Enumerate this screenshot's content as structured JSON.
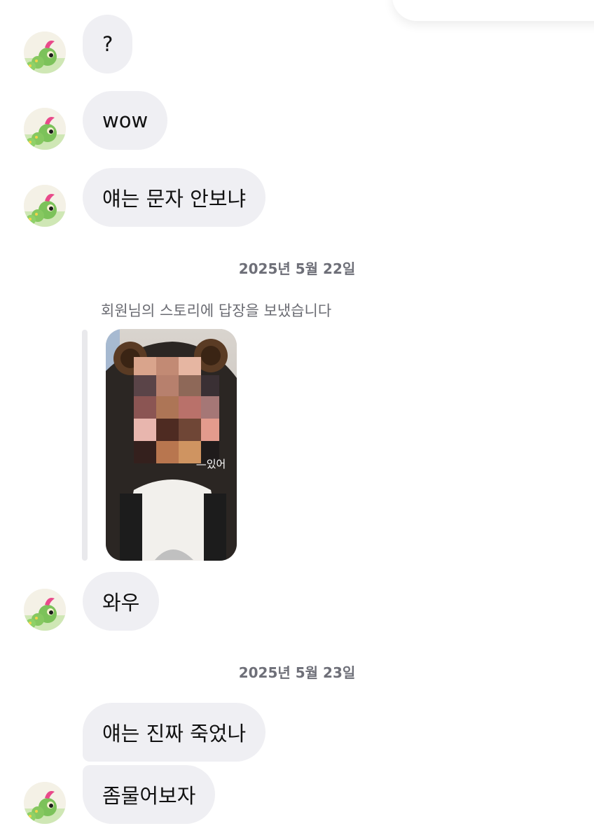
{
  "conversation": {
    "messages": [
      {
        "text": "?"
      },
      {
        "text": "wow"
      },
      {
        "text": "얘는 문자 안보냐"
      },
      {
        "text": "와우"
      },
      {
        "text": "얘는 진짜 죽었나"
      },
      {
        "text": "좀물어보자"
      }
    ],
    "date_separators": [
      {
        "text": "2025년 5월 22일"
      },
      {
        "text": "2025년 5월 23일"
      }
    ],
    "story_reply": {
      "note": "회원님의 스토리에 답장을 보냈습니다",
      "thumbnail_caption": "—있어"
    }
  },
  "colors": {
    "bubble_background": "#efeff3",
    "date_text": "#6e6f78",
    "note_text": "#6a6b72",
    "avatar_character": "#7cc25a"
  },
  "icons": {
    "avatar": "caterpie-avatar-icon"
  }
}
